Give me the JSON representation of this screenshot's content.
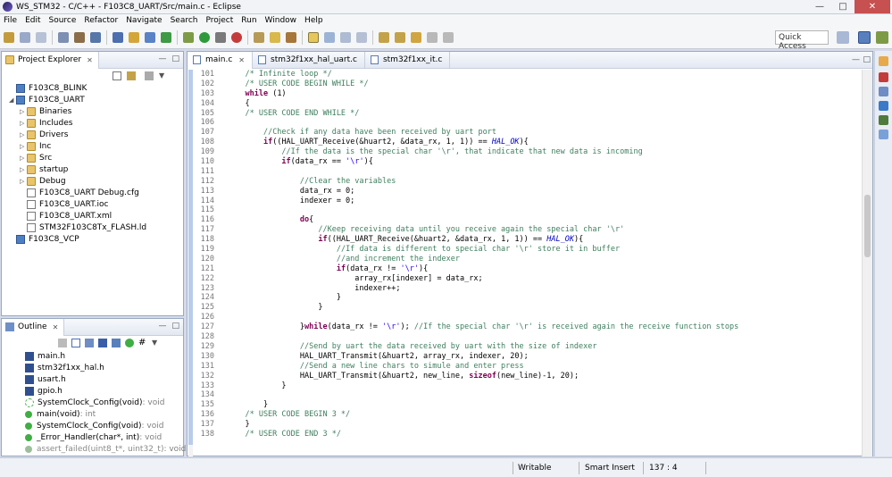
{
  "window": {
    "title": "WS_STM32 - C/C++ - F103C8_UART/Src/main.c - Eclipse"
  },
  "menu": [
    "File",
    "Edit",
    "Source",
    "Refactor",
    "Navigate",
    "Search",
    "Project",
    "Run",
    "Window",
    "Help"
  ],
  "toolbar": {
    "quick_access": "Quick Access"
  },
  "project_explorer": {
    "tab_label": "Project Explorer",
    "items": [
      {
        "label": "F103C8_BLINK",
        "kind": "project",
        "indent": 0
      },
      {
        "label": "F103C8_UART",
        "kind": "project",
        "indent": 0,
        "expanded": true
      },
      {
        "label": "Binaries",
        "kind": "folder",
        "indent": 1
      },
      {
        "label": "Includes",
        "kind": "folder",
        "indent": 1
      },
      {
        "label": "Drivers",
        "kind": "folder",
        "indent": 1
      },
      {
        "label": "Inc",
        "kind": "folder",
        "indent": 1
      },
      {
        "label": "Src",
        "kind": "folder",
        "indent": 1
      },
      {
        "label": "startup",
        "kind": "folder",
        "indent": 1
      },
      {
        "label": "Debug",
        "kind": "folder",
        "indent": 1
      },
      {
        "label": "F103C8_UART Debug.cfg",
        "kind": "file",
        "indent": 1
      },
      {
        "label": "F103C8_UART.ioc",
        "kind": "file",
        "indent": 1
      },
      {
        "label": "F103C8_UART.xml",
        "kind": "file",
        "indent": 1
      },
      {
        "label": "STM32F103C8Tx_FLASH.ld",
        "kind": "file",
        "indent": 1
      },
      {
        "label": "F103C8_VCP",
        "kind": "project",
        "indent": 0
      }
    ]
  },
  "outline": {
    "tab_label": "Outline",
    "items": [
      {
        "label": "main.h",
        "kind": "header"
      },
      {
        "label": "stm32f1xx_hal.h",
        "kind": "header"
      },
      {
        "label": "usart.h",
        "kind": "header"
      },
      {
        "label": "gpio.h",
        "kind": "header"
      },
      {
        "label": "SystemClock_Config(void)",
        "suffix": " : void",
        "kind": "decl"
      },
      {
        "label": "main(void)",
        "suffix": " : int",
        "kind": "func"
      },
      {
        "label": "SystemClock_Config(void)",
        "suffix": " : void",
        "kind": "func"
      },
      {
        "label": "_Error_Handler(char*, int)",
        "suffix": " : void",
        "kind": "func"
      },
      {
        "label": "assert_failed(uint8_t*, uint32_t)",
        "suffix": " : void",
        "kind": "func-muted"
      }
    ]
  },
  "editor": {
    "tabs": [
      {
        "label": "main.c",
        "active": true
      },
      {
        "label": "stm32f1xx_hal_uart.c",
        "active": false
      },
      {
        "label": "stm32f1xx_it.c",
        "active": false
      }
    ],
    "lines": [
      {
        "n": "101",
        "code": "    /* Infinite loop */"
      },
      {
        "n": "102",
        "code": "    /* USER CODE BEGIN WHILE */"
      },
      {
        "n": "103",
        "code": "    while (1)"
      },
      {
        "n": "104",
        "code": "    {"
      },
      {
        "n": "105",
        "code": "    /* USER CODE END WHILE */"
      },
      {
        "n": "106",
        "code": ""
      },
      {
        "n": "107",
        "code": "        //Check if any data have been received by uart port"
      },
      {
        "n": "108",
        "code": "        if((HAL_UART_Receive(&huart2, &data_rx, 1, 1)) == HAL_OK){"
      },
      {
        "n": "109",
        "code": "            //If the data is the special char '\\r', that indicate that new data is incoming"
      },
      {
        "n": "110",
        "code": "            if(data_rx == '\\r'){"
      },
      {
        "n": "111",
        "code": ""
      },
      {
        "n": "112",
        "code": "                //Clear the variables"
      },
      {
        "n": "113",
        "code": "                data_rx = 0;"
      },
      {
        "n": "114",
        "code": "                indexer = 0;"
      },
      {
        "n": "115",
        "code": ""
      },
      {
        "n": "116",
        "code": "                do{"
      },
      {
        "n": "117",
        "code": "                    //Keep receiving data until you receive again the special char '\\r'"
      },
      {
        "n": "118",
        "code": "                    if((HAL_UART_Receive(&huart2, &data_rx, 1, 1)) == HAL_OK){"
      },
      {
        "n": "119",
        "code": "                        //If data is different to special char '\\r' store it in buffer"
      },
      {
        "n": "120",
        "code": "                        //and increment the indexer"
      },
      {
        "n": "121",
        "code": "                        if(data_rx != '\\r'){"
      },
      {
        "n": "122",
        "code": "                            array_rx[indexer] = data_rx;"
      },
      {
        "n": "123",
        "code": "                            indexer++;"
      },
      {
        "n": "124",
        "code": "                        }"
      },
      {
        "n": "125",
        "code": "                    }"
      },
      {
        "n": "126",
        "code": ""
      },
      {
        "n": "127",
        "code": "                }while(data_rx != '\\r'); //If the special char '\\r' is received again the receive function stops"
      },
      {
        "n": "128",
        "code": ""
      },
      {
        "n": "129",
        "code": "                //Send by uart the data received by uart with the size of indexer"
      },
      {
        "n": "130",
        "code": "                HAL_UART_Transmit(&huart2, array_rx, indexer, 20);"
      },
      {
        "n": "131",
        "code": "                //Send a new line chars to simule and enter press"
      },
      {
        "n": "132",
        "code": "                HAL_UART_Transmit(&huart2, new_line, sizeof(new_line)-1, 20);"
      },
      {
        "n": "133",
        "code": "            }"
      },
      {
        "n": "134",
        "code": ""
      },
      {
        "n": "135",
        "code": "        }"
      },
      {
        "n": "136",
        "code": "    /* USER CODE BEGIN 3 */"
      },
      {
        "n": "137",
        "code": "    }"
      },
      {
        "n": "138",
        "code": "    /* USER CODE END 3 */"
      }
    ]
  },
  "status": {
    "mode": "Writable",
    "insert": "Smart Insert",
    "position": "137 : 4"
  },
  "colors": {
    "comment": "#3f7f5f",
    "keyword": "#7f0055",
    "constant": "#0000c0",
    "string": "#2a00ff"
  }
}
